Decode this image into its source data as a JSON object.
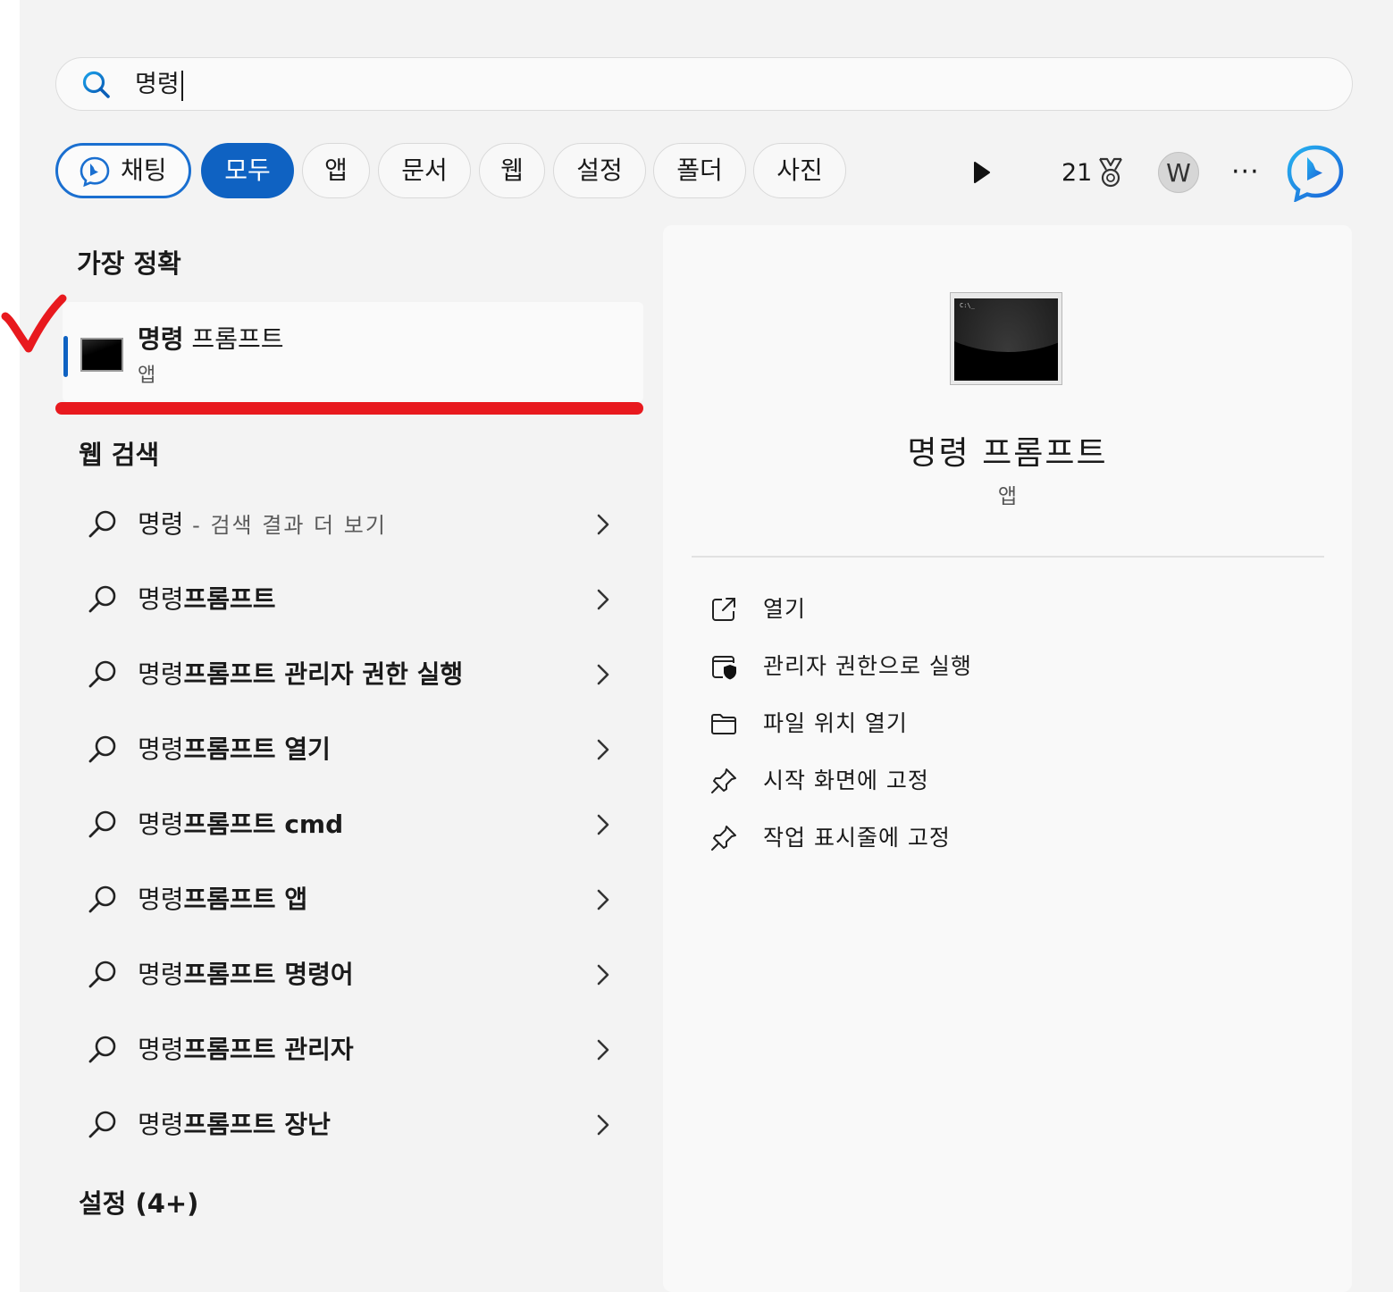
{
  "search": {
    "query": "명령"
  },
  "chips": {
    "chat": "채팅",
    "all": "모두",
    "apps": "앱",
    "documents": "문서",
    "web": "웹",
    "settings": "설정",
    "folders": "폴더",
    "photos": "사진"
  },
  "toolbar": {
    "points": "21",
    "avatar_initial": "W",
    "more": "···"
  },
  "best_match": {
    "heading": "가장 정확",
    "name_bold": "명령",
    "name_rest": " 프롬프트",
    "type": "앱"
  },
  "web_search": {
    "heading": "웹 검색",
    "first": {
      "query": "명령",
      "suffix": " - 검색 결과 더 보기"
    },
    "items": [
      {
        "prefix": "명령",
        "bold": "프롬프트"
      },
      {
        "prefix": "명령",
        "bold": "프롬프트 관리자 권한 실행"
      },
      {
        "prefix": "명령",
        "bold": "프롬프트 열기"
      },
      {
        "prefix": "명령",
        "bold": "프롬프트 cmd"
      },
      {
        "prefix": "명령",
        "bold": "프롬프트 앱"
      },
      {
        "prefix": "명령",
        "bold": "프롬프트 명령어"
      },
      {
        "prefix": "명령",
        "bold": "프롬프트 관리자"
      },
      {
        "prefix": "명령",
        "bold": "프롬프트 장난"
      }
    ]
  },
  "settings_section": {
    "heading": "설정 (4+)"
  },
  "details": {
    "title": "명령 프롬프트",
    "type": "앱",
    "icon_prompt": "C:\\_",
    "actions": [
      {
        "icon": "open-external-icon",
        "label": "열기"
      },
      {
        "icon": "shield-window-icon",
        "label": "관리자 권한으로 실행"
      },
      {
        "icon": "folder-icon",
        "label": "파일 위치 열기"
      },
      {
        "icon": "pin-icon",
        "label": "시작 화면에 고정"
      },
      {
        "icon": "pin-icon",
        "label": "작업 표시줄에 고정"
      }
    ]
  },
  "colors": {
    "accent": "#0f62c2",
    "annotation_red": "#e8191e",
    "panel_bg": "#f3f3f3"
  }
}
